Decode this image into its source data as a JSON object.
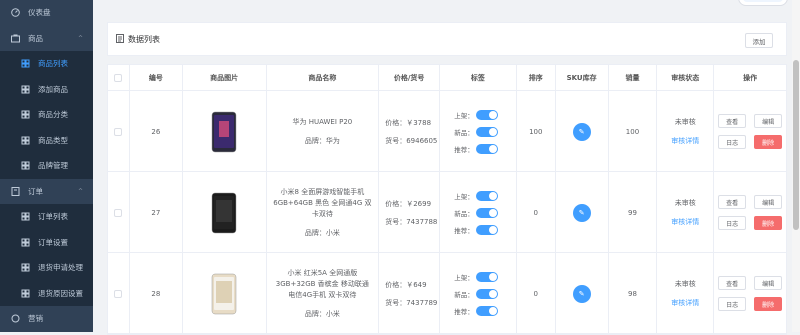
{
  "sidebar": {
    "items": [
      {
        "label": "仪表盘",
        "icon": "dashboard-icon",
        "type": "top"
      },
      {
        "label": "商品",
        "icon": "goods-icon",
        "type": "top",
        "arrow": "^"
      },
      {
        "label": "商品列表",
        "icon": "list-icon",
        "type": "sub",
        "active": true
      },
      {
        "label": "添加商品",
        "icon": "add-icon",
        "type": "sub"
      },
      {
        "label": "商品分类",
        "icon": "category-icon",
        "type": "sub"
      },
      {
        "label": "商品类型",
        "icon": "type-icon",
        "type": "sub"
      },
      {
        "label": "品牌管理",
        "icon": "brand-icon",
        "type": "sub"
      },
      {
        "label": "订单",
        "icon": "order-icon",
        "type": "top",
        "arrow": "^"
      },
      {
        "label": "订单列表",
        "icon": "list-icon",
        "type": "sub"
      },
      {
        "label": "订单设置",
        "icon": "settings-icon",
        "type": "sub"
      },
      {
        "label": "退货申请处理",
        "icon": "return-icon",
        "type": "sub"
      },
      {
        "label": "退货原因设置",
        "icon": "reason-icon",
        "type": "sub"
      },
      {
        "label": "营销",
        "icon": "marketing-icon",
        "type": "top"
      }
    ]
  },
  "panel": {
    "title": "数据列表",
    "add_label": "添加"
  },
  "table": {
    "headers": [
      "",
      "编号",
      "商品图片",
      "商品名称",
      "价格/货号",
      "标签",
      "排序",
      "SKU库存",
      "销量",
      "审核状态",
      "操作"
    ],
    "rows": [
      {
        "id": "26",
        "name": "华为 HUAWEI P20",
        "brand": "品牌：华为",
        "price": "价格：￥3788",
        "sn": "货号：6946605",
        "tags": [
          "上架：",
          "新品：",
          "推荐："
        ],
        "sort": "100",
        "sales": "100",
        "status": "未审核",
        "detail": "审核详情",
        "phone_color": "#2a2a3a"
      },
      {
        "id": "27",
        "name": "小米8 全面屏游戏智能手机 6GB+64GB 黑色 全网通4G 双卡双待",
        "brand": "品牌：小米",
        "price": "价格：￥2699",
        "sn": "货号：7437788",
        "tags": [
          "上架：",
          "新品：",
          "推荐："
        ],
        "sort": "0",
        "sales": "99",
        "status": "未审核",
        "detail": "审核详情",
        "phone_color": "#1b1b1b"
      },
      {
        "id": "28",
        "name": "小米 红米5A 全网通版 3GB+32GB 香槟金 移动联通电信4G手机 双卡双待",
        "brand": "品牌：小米",
        "price": "价格：￥649",
        "sn": "货号：7437789",
        "tags": [
          "上架：",
          "新品：",
          "推荐："
        ],
        "sort": "0",
        "sales": "98",
        "status": "未审核",
        "detail": "审核详情",
        "phone_color": "#e8dcc6"
      }
    ],
    "ops": {
      "view": "查看",
      "edit": "编辑",
      "log": "日志",
      "delete": "删除"
    }
  },
  "colors": {
    "primary": "#409eff",
    "danger": "#f56c6c",
    "sidebar_bg": "#304156"
  }
}
